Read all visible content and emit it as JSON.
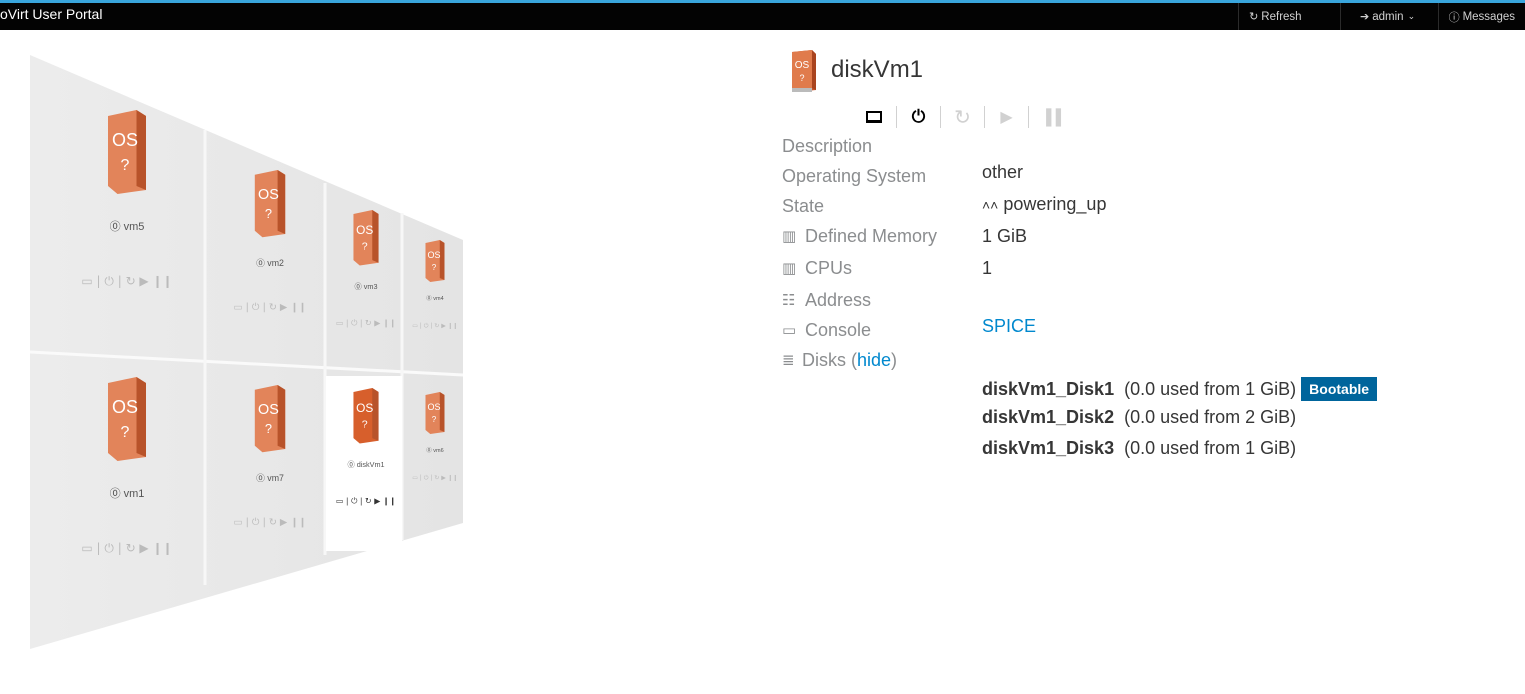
{
  "header": {
    "brand": "oVirt User Portal",
    "refresh": "Refresh",
    "user": "admin",
    "messages": "Messages",
    "accent_color": "#39a5dc"
  },
  "vm_wall": {
    "cards": [
      {
        "name": "vm5",
        "selected": false
      },
      {
        "name": "vm2",
        "selected": false
      },
      {
        "name": "vm3",
        "selected": false
      },
      {
        "name": "vm4",
        "selected": false
      },
      {
        "name": "vm1",
        "selected": false
      },
      {
        "name": "vm7",
        "selected": false
      },
      {
        "name": "diskVm1",
        "selected": true
      },
      {
        "name": "vm6",
        "selected": false
      }
    ],
    "os_label": "OS",
    "os_unknown": "?"
  },
  "detail": {
    "title": "diskVm1",
    "actions": [
      {
        "name": "console",
        "icon": "monitor-icon",
        "enabled": true
      },
      {
        "name": "shutdown",
        "icon": "power-icon",
        "enabled": true
      },
      {
        "name": "reboot",
        "icon": "refresh-icon",
        "enabled": false
      },
      {
        "name": "start",
        "icon": "play-icon",
        "enabled": false
      },
      {
        "name": "suspend",
        "icon": "pause-icon",
        "enabled": false
      }
    ],
    "fields": {
      "description_label": "Description",
      "description_value": "",
      "os_label": "Operating System",
      "os_value": "other",
      "state_label": "State",
      "state_value": "powering_up",
      "memory_label": "Defined Memory",
      "memory_value": "1 GiB",
      "cpus_label": "CPUs",
      "cpus_value": "1",
      "address_label": "Address",
      "address_value": "",
      "console_label": "Console",
      "console_value": "SPICE",
      "disks_label": "Disks",
      "disks_hide": "hide"
    },
    "disks": [
      {
        "name": "diskVm1_Disk1",
        "usage": "(0.0 used from 1 GiB)",
        "badge": "Bootable"
      },
      {
        "name": "diskVm1_Disk2",
        "usage": "(0.0 used from 2 GiB)",
        "badge": ""
      },
      {
        "name": "diskVm1_Disk3",
        "usage": "(0.0 used from 1 GiB)",
        "badge": ""
      }
    ]
  }
}
